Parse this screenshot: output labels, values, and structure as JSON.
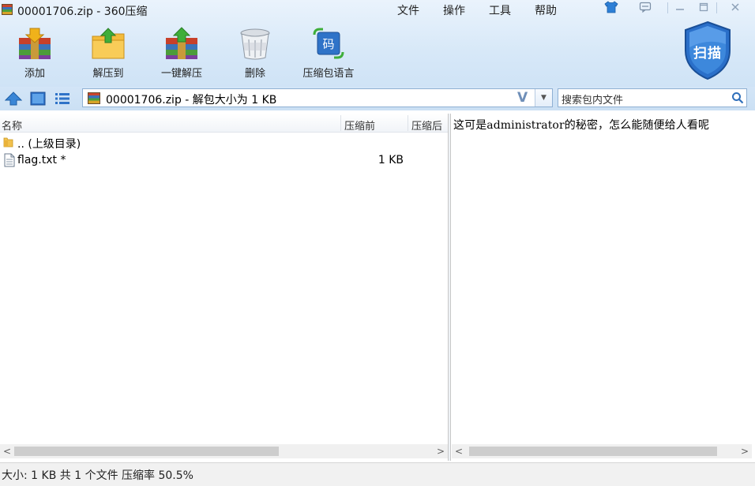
{
  "window": {
    "title": "00001706.zip - 360压缩",
    "menu": [
      "文件",
      "操作",
      "工具",
      "帮助"
    ]
  },
  "toolbar": {
    "add_label": "添加",
    "extract_to_label": "解压到",
    "one_click_extract_label": "一键解压",
    "delete_label": "删除",
    "archive_language_label": "压缩包语言",
    "archive_language_icon_text": "码",
    "scan_label": "扫描"
  },
  "nav": {
    "path_text": "00001706.zip - 解包大小为 1 KB",
    "path_v_glyph": "V",
    "search_placeholder": "搜索包内文件"
  },
  "file_list": {
    "columns": [
      "名称",
      "压缩前",
      "压缩后"
    ],
    "rows": [
      {
        "name": ".. (上级目录)",
        "size": "",
        "type": "folder"
      },
      {
        "name": "flag.txt *",
        "size": "1 KB",
        "type": "file"
      }
    ]
  },
  "preview": {
    "text": "这可是administrator的秘密，怎么能随便给人看呢"
  },
  "status": {
    "text": "大小: 1 KB 共 1 个文件 压缩率 50.5%"
  },
  "colors": {
    "accent_blue": "#3b7fd1",
    "toolbar_bg": "#d7e8f8",
    "shield_blue": "#2a6fc9"
  }
}
